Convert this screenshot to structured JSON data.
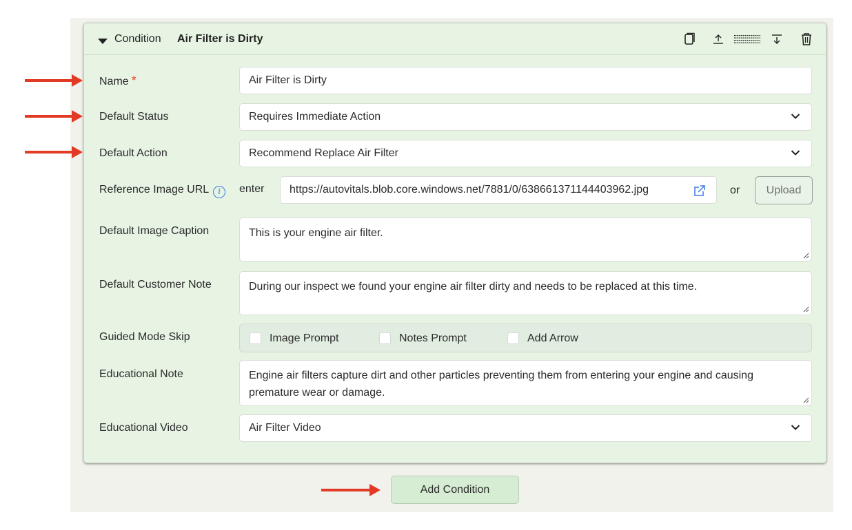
{
  "condition": {
    "header_label": "Condition",
    "header_name": "Air Filter is Dirty",
    "header_icons": [
      "copy-icon",
      "move-up-icon",
      "drag-handle-icon",
      "move-down-icon",
      "trash-icon"
    ]
  },
  "fields": {
    "name": {
      "label": "Name",
      "required_mark": "*",
      "value": "Air Filter is Dirty"
    },
    "default_status": {
      "label": "Default Status",
      "value": "Requires Immediate Action"
    },
    "default_action": {
      "label": "Default Action",
      "value": "Recommend Replace Air Filter"
    },
    "reference_image": {
      "label": "Reference Image URL",
      "info_glyph": "i",
      "enter_text": "enter",
      "value": "https://autovitals.blob.core.windows.net/7881/0/638661371144403962.jpg",
      "or_text": "or",
      "upload_label": "Upload"
    },
    "image_caption": {
      "label": "Default Image Caption",
      "value": "This is your engine air filter."
    },
    "customer_note": {
      "label": "Default Customer Note",
      "value": "During our inspect we found your engine air filter dirty and needs to be replaced at this time."
    },
    "guided_mode_skip": {
      "label": "Guided Mode Skip",
      "options": [
        {
          "label": "Image Prompt",
          "checked": false
        },
        {
          "label": "Notes Prompt",
          "checked": false
        },
        {
          "label": "Add Arrow",
          "checked": false
        }
      ]
    },
    "educational_note": {
      "label": "Educational Note",
      "value": "Engine air filters capture dirt and other particles preventing them from entering your engine and causing premature wear or damage."
    },
    "educational_video": {
      "label": "Educational Video",
      "value": "Air Filter Video"
    }
  },
  "add_condition_label": "Add Condition",
  "colors": {
    "annotation_arrow": "#e23a24",
    "card_bg": "#e7f4e4",
    "button_bg": "#d6edd3",
    "info_blue": "#3d7ae0"
  }
}
